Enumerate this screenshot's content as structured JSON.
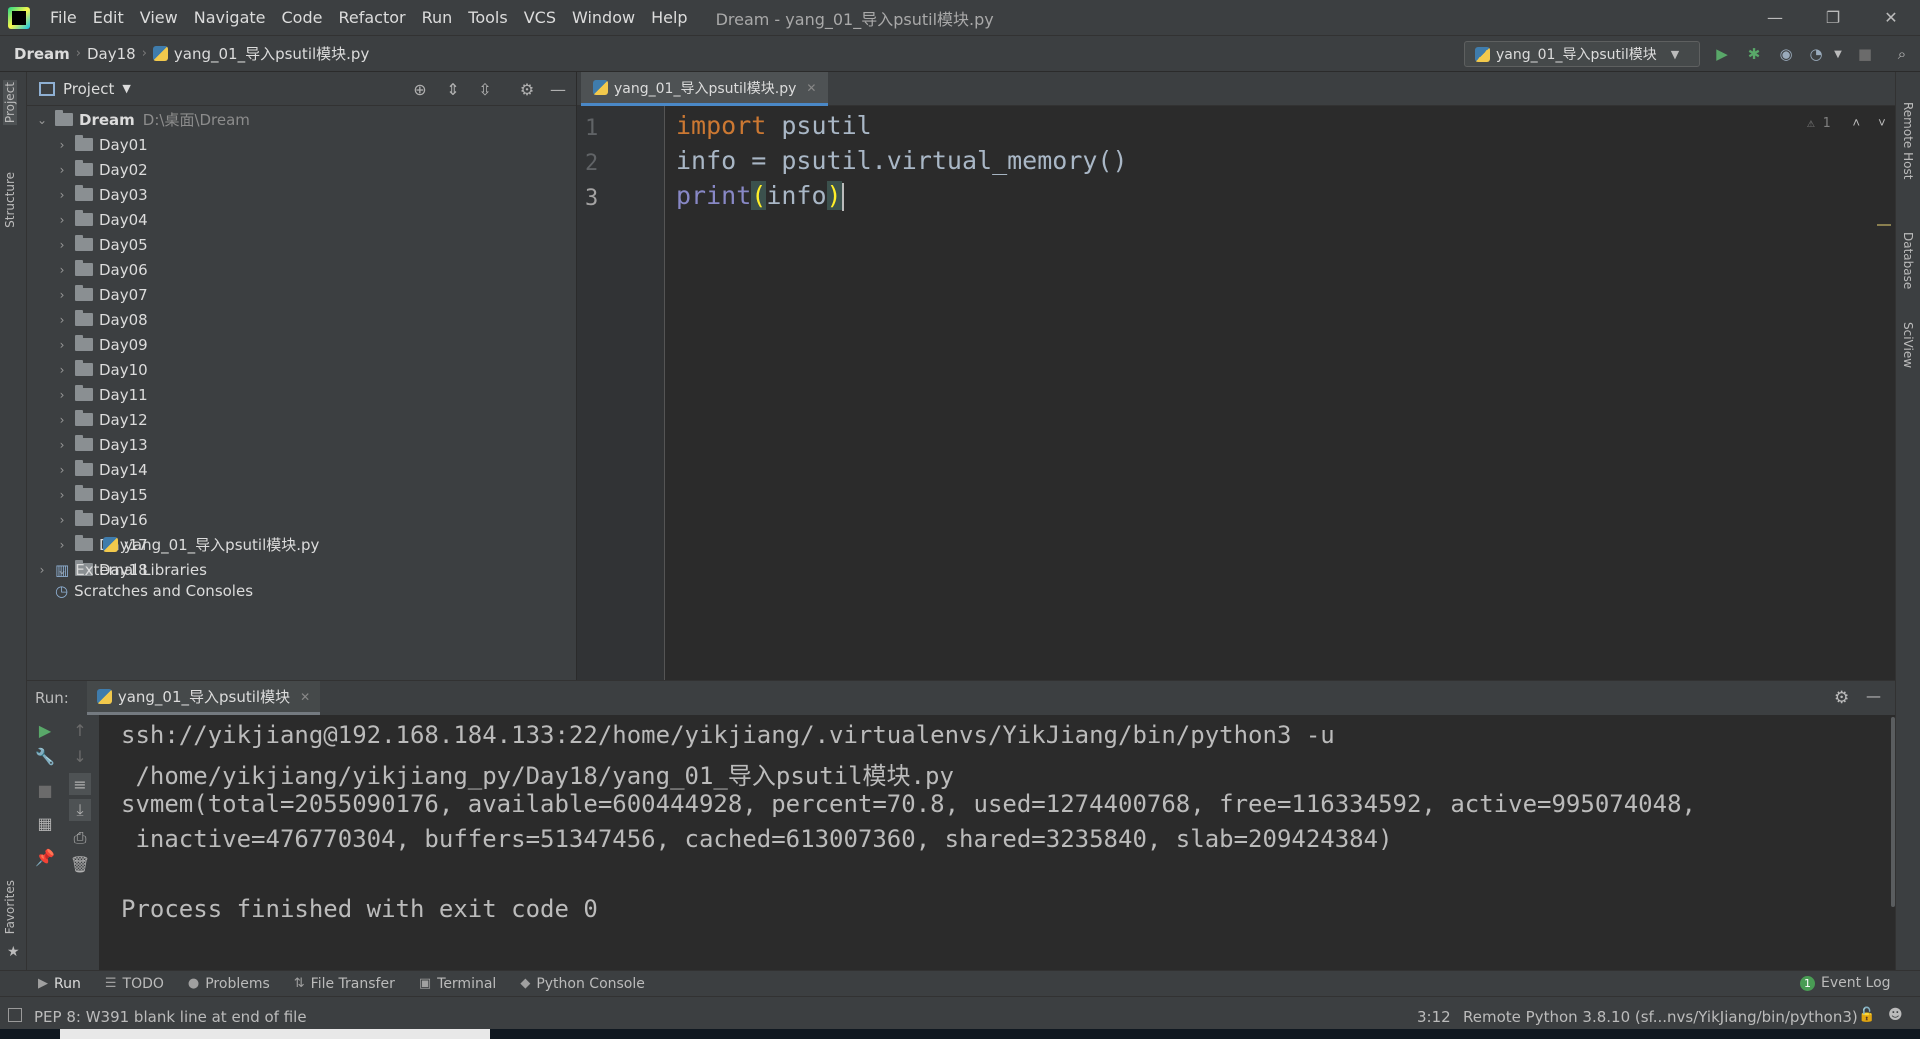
{
  "menu": [
    "File",
    "Edit",
    "View",
    "Navigate",
    "Code",
    "Refactor",
    "Run",
    "Tools",
    "VCS",
    "Window",
    "Help"
  ],
  "window_title": "Dream - yang_01_导入psutil模块.py",
  "window_controls": {
    "minimize": "—",
    "restore": "❐",
    "close": "✕"
  },
  "breadcrumb": [
    "Dream",
    "Day18",
    "yang_01_导入psutil模块.py"
  ],
  "run_config": "yang_01_导入psutil模块",
  "project_panel": {
    "title": "Project",
    "root": {
      "name": "Dream",
      "path": "D:\\桌面\\Dream"
    },
    "folders": [
      "Day01",
      "Day02",
      "Day03",
      "Day04",
      "Day05",
      "Day06",
      "Day07",
      "Day08",
      "Day09",
      "Day10",
      "Day11",
      "Day12",
      "Day13",
      "Day14",
      "Day15",
      "Day16",
      "Day17",
      "Day18"
    ],
    "file": "yang_01_导入psutil模块.py",
    "external_libraries": "External Libraries",
    "scratches": "Scratches and Consoles"
  },
  "left_strip": {
    "project": "Project",
    "structure": "Structure",
    "favorites": "Favorites"
  },
  "right_strip": {
    "remote_host": "Remote Host",
    "database": "Database",
    "sciview": "SciView"
  },
  "editor": {
    "tab": "yang_01_导入psutil模块.py",
    "line_numbers": [
      "1",
      "2",
      "3"
    ],
    "line1": {
      "kw": "import",
      "rest": " psutil"
    },
    "line2": "info = psutil.virtual_memory()",
    "line3": {
      "fn": "print",
      "open": "(",
      "arg": "info",
      "close": ")"
    },
    "warning_count": "1"
  },
  "run_panel": {
    "label": "Run:",
    "tab": "yang_01_导入psutil模块",
    "console": [
      "ssh://yikjiang@192.168.184.133:22/home/yikjiang/.virtualenvs/YikJiang/bin/python3 -u",
      " /home/yikjiang/yikjiang_py/Day18/yang_01_导入psutil模块.py",
      "svmem(total=2055090176, available=600444928, percent=70.8, used=1274400768, free=116334592, active=995074048,",
      " inactive=476770304, buffers=51347456, cached=613007360, shared=3235840, slab=209424384)",
      "",
      "Process finished with exit code 0"
    ]
  },
  "bottom_tabs": [
    "Run",
    "TODO",
    "Problems",
    "File Transfer",
    "Terminal",
    "Python Console"
  ],
  "event_log": {
    "count": "1",
    "label": "Event Log"
  },
  "status": {
    "message": "PEP 8: W391 blank line at end of file",
    "position": "3:12",
    "interpreter": "Remote Python 3.8.10 (sf...nvs/YikJiang/bin/python3)"
  },
  "colors": {
    "keyword": "#cc7832",
    "builtin": "#8888c6",
    "accent": "#4a88c7",
    "run_green": "#59a869"
  }
}
